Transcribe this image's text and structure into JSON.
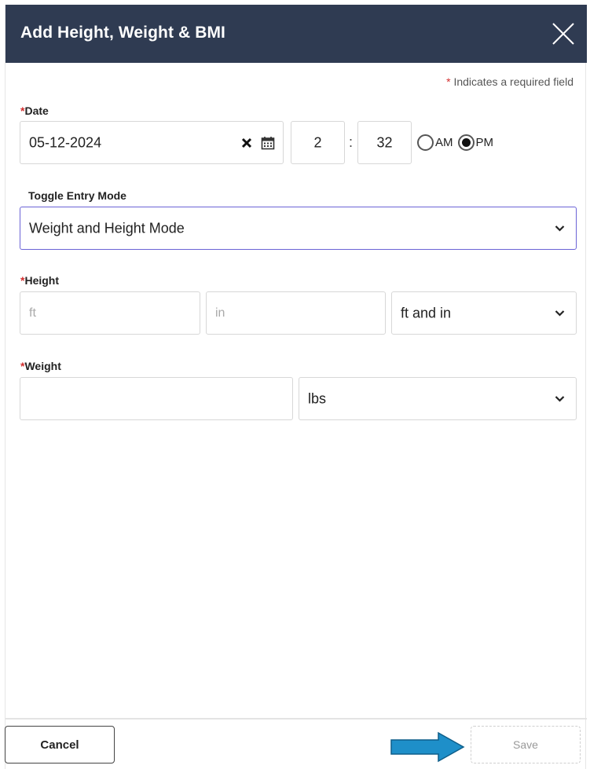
{
  "dialog": {
    "title": "Add Height, Weight & BMI",
    "required_note_star": "*",
    "required_note": " Indicates a required field"
  },
  "date": {
    "label_star": "*",
    "label": "Date",
    "value": "05-12-2024",
    "hour": "2",
    "colon": ":",
    "minute": "32",
    "am_label": "AM",
    "pm_label": "PM",
    "selected_period": "PM"
  },
  "entry_mode": {
    "label": "Toggle Entry Mode",
    "selected": "Weight and Height Mode"
  },
  "height": {
    "label_star": "*",
    "label": "Height",
    "ft_placeholder": "ft",
    "in_placeholder": "in",
    "unit_selected": "ft and in"
  },
  "weight": {
    "label_star": "*",
    "label": "Weight",
    "value": "",
    "unit_selected": "lbs"
  },
  "footer": {
    "cancel_label": "Cancel",
    "save_label": "Save"
  },
  "colors": {
    "header_bg": "#2f3b52",
    "required_star": "#d32f2f",
    "focus_border": "#6b63d6",
    "arrow_fill": "#1e8fc9"
  }
}
